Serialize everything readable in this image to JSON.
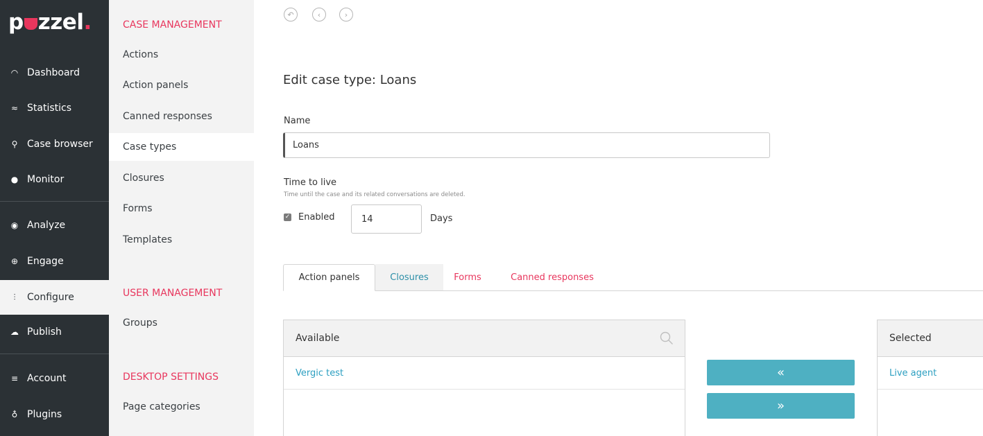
{
  "brand": {
    "logo_start": "p",
    "logo_end": "zzel",
    "logo_dot": ".",
    "accent": "#e8365d",
    "nav_bg": "#2b3135",
    "button_color": "#4eb0c2"
  },
  "leftnav": {
    "items": [
      {
        "label": "Dashboard",
        "icon": "gauge-icon",
        "glyph": "◠"
      },
      {
        "label": "Statistics",
        "icon": "chart-icon",
        "glyph": "≈"
      },
      {
        "label": "Case browser",
        "icon": "search-icon",
        "glyph": "⚲"
      },
      {
        "label": "Monitor",
        "icon": "binoculars-icon",
        "glyph": "●"
      },
      {
        "label": "Analyze",
        "icon": "eye-icon",
        "glyph": "◉"
      },
      {
        "label": "Engage",
        "icon": "globe-icon",
        "glyph": "⊕"
      },
      {
        "label": "Configure",
        "icon": "sliders-icon",
        "glyph": "⫶"
      },
      {
        "label": "Publish",
        "icon": "cloud-upload-icon",
        "glyph": "☁"
      },
      {
        "label": "Account",
        "icon": "list-icon",
        "glyph": "≡"
      },
      {
        "label": "Plugins",
        "icon": "lightbulb-icon",
        "glyph": "♁"
      }
    ]
  },
  "subnav": {
    "case_management": "CASE MANAGEMENT",
    "items": [
      "Actions",
      "Action panels",
      "Canned responses",
      "Case types",
      "Closures",
      "Forms",
      "Templates"
    ],
    "user_management": "USER MANAGEMENT",
    "user_items": [
      "Groups"
    ],
    "desktop_settings": "DESKTOP SETTINGS",
    "desktop_items": [
      "Page categories"
    ]
  },
  "toolbar": {
    "undo_glyph": "↶",
    "back_glyph": "‹",
    "forward_glyph": "›"
  },
  "form": {
    "title_prefix": "Edit case type:",
    "title_value": "Loans",
    "name_label": "Name",
    "name_value": "Loans",
    "ttl_label": "Time to live",
    "ttl_hint": "Time until the case and its related conversations are deleted.",
    "enabled_label": "Enabled",
    "enabled_checked": true,
    "days_value": "14",
    "days_label": "Days"
  },
  "tabs": [
    "Action panels",
    "Closures",
    "Forms",
    "Canned responses"
  ],
  "available": {
    "header": "Available",
    "items": [
      "Vergic test"
    ]
  },
  "selected": {
    "header": "Selected",
    "items": [
      "Live agent"
    ]
  },
  "buttons": {
    "remove_glyph": "«",
    "add_glyph": "»"
  }
}
